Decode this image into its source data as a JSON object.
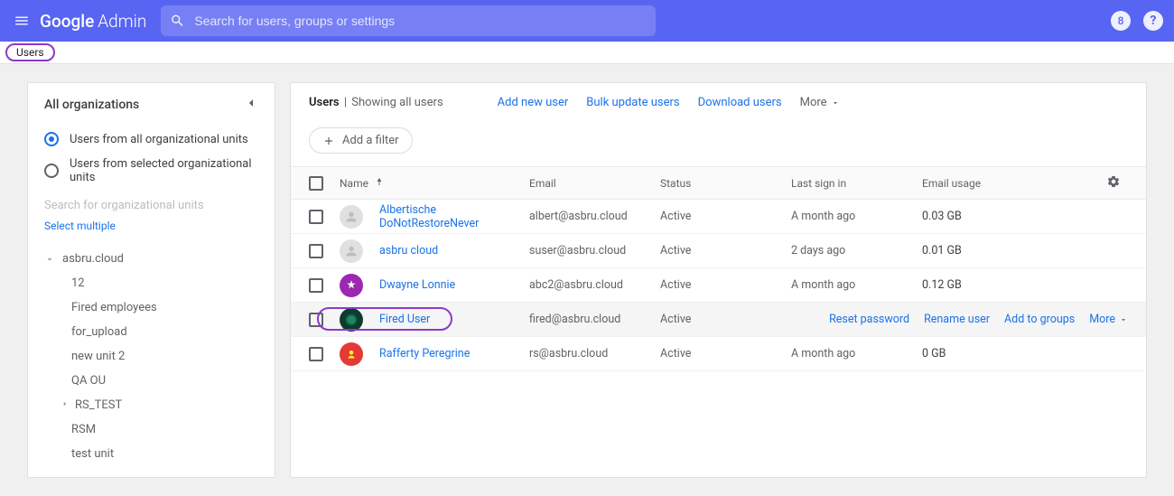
{
  "header": {
    "logo_main": "Google",
    "logo_sub": "Admin",
    "search_placeholder": "Search for users, groups or settings",
    "avatar_letter": "8"
  },
  "breadcrumb": {
    "current": "Users"
  },
  "sidepanel": {
    "title": "All organizations",
    "radio_all": "Users from all organizational units",
    "radio_selected": "Users from selected organizational units",
    "org_search_placeholder": "Search for organizational units",
    "select_multiple": "Select multiple",
    "org_root": "asbru.cloud",
    "org_children": [
      "12",
      "Fired employees",
      "for_upload",
      "new unit 2",
      "QA OU",
      "RS_TEST",
      "RSM",
      "test unit"
    ],
    "org_child_expandable_index": 5
  },
  "main": {
    "title": "Users",
    "subtitle": "Showing all users",
    "actions": [
      "Add new user",
      "Bulk update users",
      "Download users"
    ],
    "more": "More",
    "add_filter": "Add a filter",
    "columns": {
      "name": "Name",
      "email": "Email",
      "status": "Status",
      "signin": "Last sign in",
      "usage": "Email usage"
    },
    "rows": [
      {
        "name": "Albertische DoNotRestoreNever",
        "email": "albert@asbru.cloud",
        "status": "Active",
        "signin": "A month ago",
        "usage": "0.03 GB",
        "avatar": "default"
      },
      {
        "name": "asbru cloud",
        "email": "suser@asbru.cloud",
        "status": "Active",
        "signin": "2 days ago",
        "usage": "0.01 GB",
        "avatar": "default"
      },
      {
        "name": "Dwayne Lonnie",
        "email": "abc2@asbru.cloud",
        "status": "Active",
        "signin": "A month ago",
        "usage": "0.12 GB",
        "avatar": "purple"
      },
      {
        "name": "Fired User",
        "email": "fired@asbru.cloud",
        "status": "Active",
        "signin": "",
        "usage": "",
        "avatar": "dark",
        "hovered": true
      },
      {
        "name": "Rafferty Peregrine",
        "email": "rs@asbru.cloud",
        "status": "Active",
        "signin": "A month ago",
        "usage": "0 GB",
        "avatar": "red"
      }
    ],
    "row_actions": [
      "Reset password",
      "Rename user",
      "Add to groups"
    ],
    "row_more": "More"
  }
}
